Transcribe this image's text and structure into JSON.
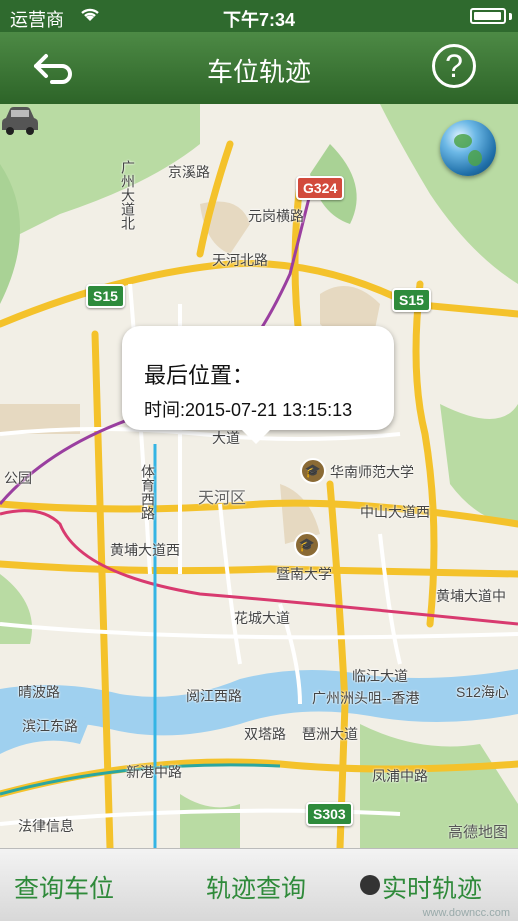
{
  "status_bar": {
    "carrier": "运营商",
    "time": "下午7:34",
    "battery_level": 0.95
  },
  "nav": {
    "title": "车位轨迹",
    "help_label": "?"
  },
  "map": {
    "labels": [
      "京溪路",
      "元岗横路",
      "天河北路",
      "大道",
      "华南师范大学",
      "天河区",
      "中山大道西",
      "黄埔大道西",
      "暨南大学",
      "花城大道",
      "黄埔大道中",
      "临江大道",
      "广州洲头咀--香港",
      "阅江西路",
      "晴波路",
      "滨江东路",
      "双塔路",
      "琶洲大道",
      "新港中路",
      "凤浦中路",
      "法律信息",
      "公园",
      "体育西路",
      "广州大道北",
      "黄埔大道中"
    ],
    "shields": [
      "G324",
      "S15",
      "S15",
      "S303",
      "S12海心"
    ],
    "watermark": "高德地图"
  },
  "popup": {
    "title": "最后位置：",
    "time": "时间:2015-07-21 13:15:13"
  },
  "tabs": {
    "query_spot": "查询车位",
    "track_query": "轨迹查询",
    "realtime_track": "实时轨迹"
  },
  "footer": {
    "site": "www.downcc.com"
  }
}
